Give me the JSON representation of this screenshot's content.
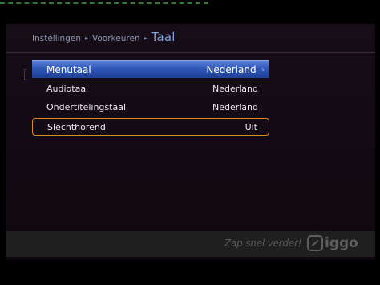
{
  "breadcrumb": {
    "items": [
      "Instellingen",
      "Voorkeuren"
    ],
    "separator": "▸",
    "current": "Taal"
  },
  "menu": {
    "rows": [
      {
        "label": "Menutaal",
        "value": "Nederland",
        "selected": true
      },
      {
        "label": "Audiotaal",
        "value": "Nederland"
      },
      {
        "label": "Ondertitelingstaal",
        "value": "Nederland"
      },
      {
        "label": "Slechthorend",
        "value": "Uit",
        "focused": true
      }
    ],
    "chevron": "›"
  },
  "footer": {
    "slogan": "Zap snel verder!",
    "logo_text": "iggo"
  },
  "colors": {
    "selection": "#2f57b8",
    "focus_outline": "#e08a1c",
    "breadcrumb_current": "#7da0d8"
  }
}
